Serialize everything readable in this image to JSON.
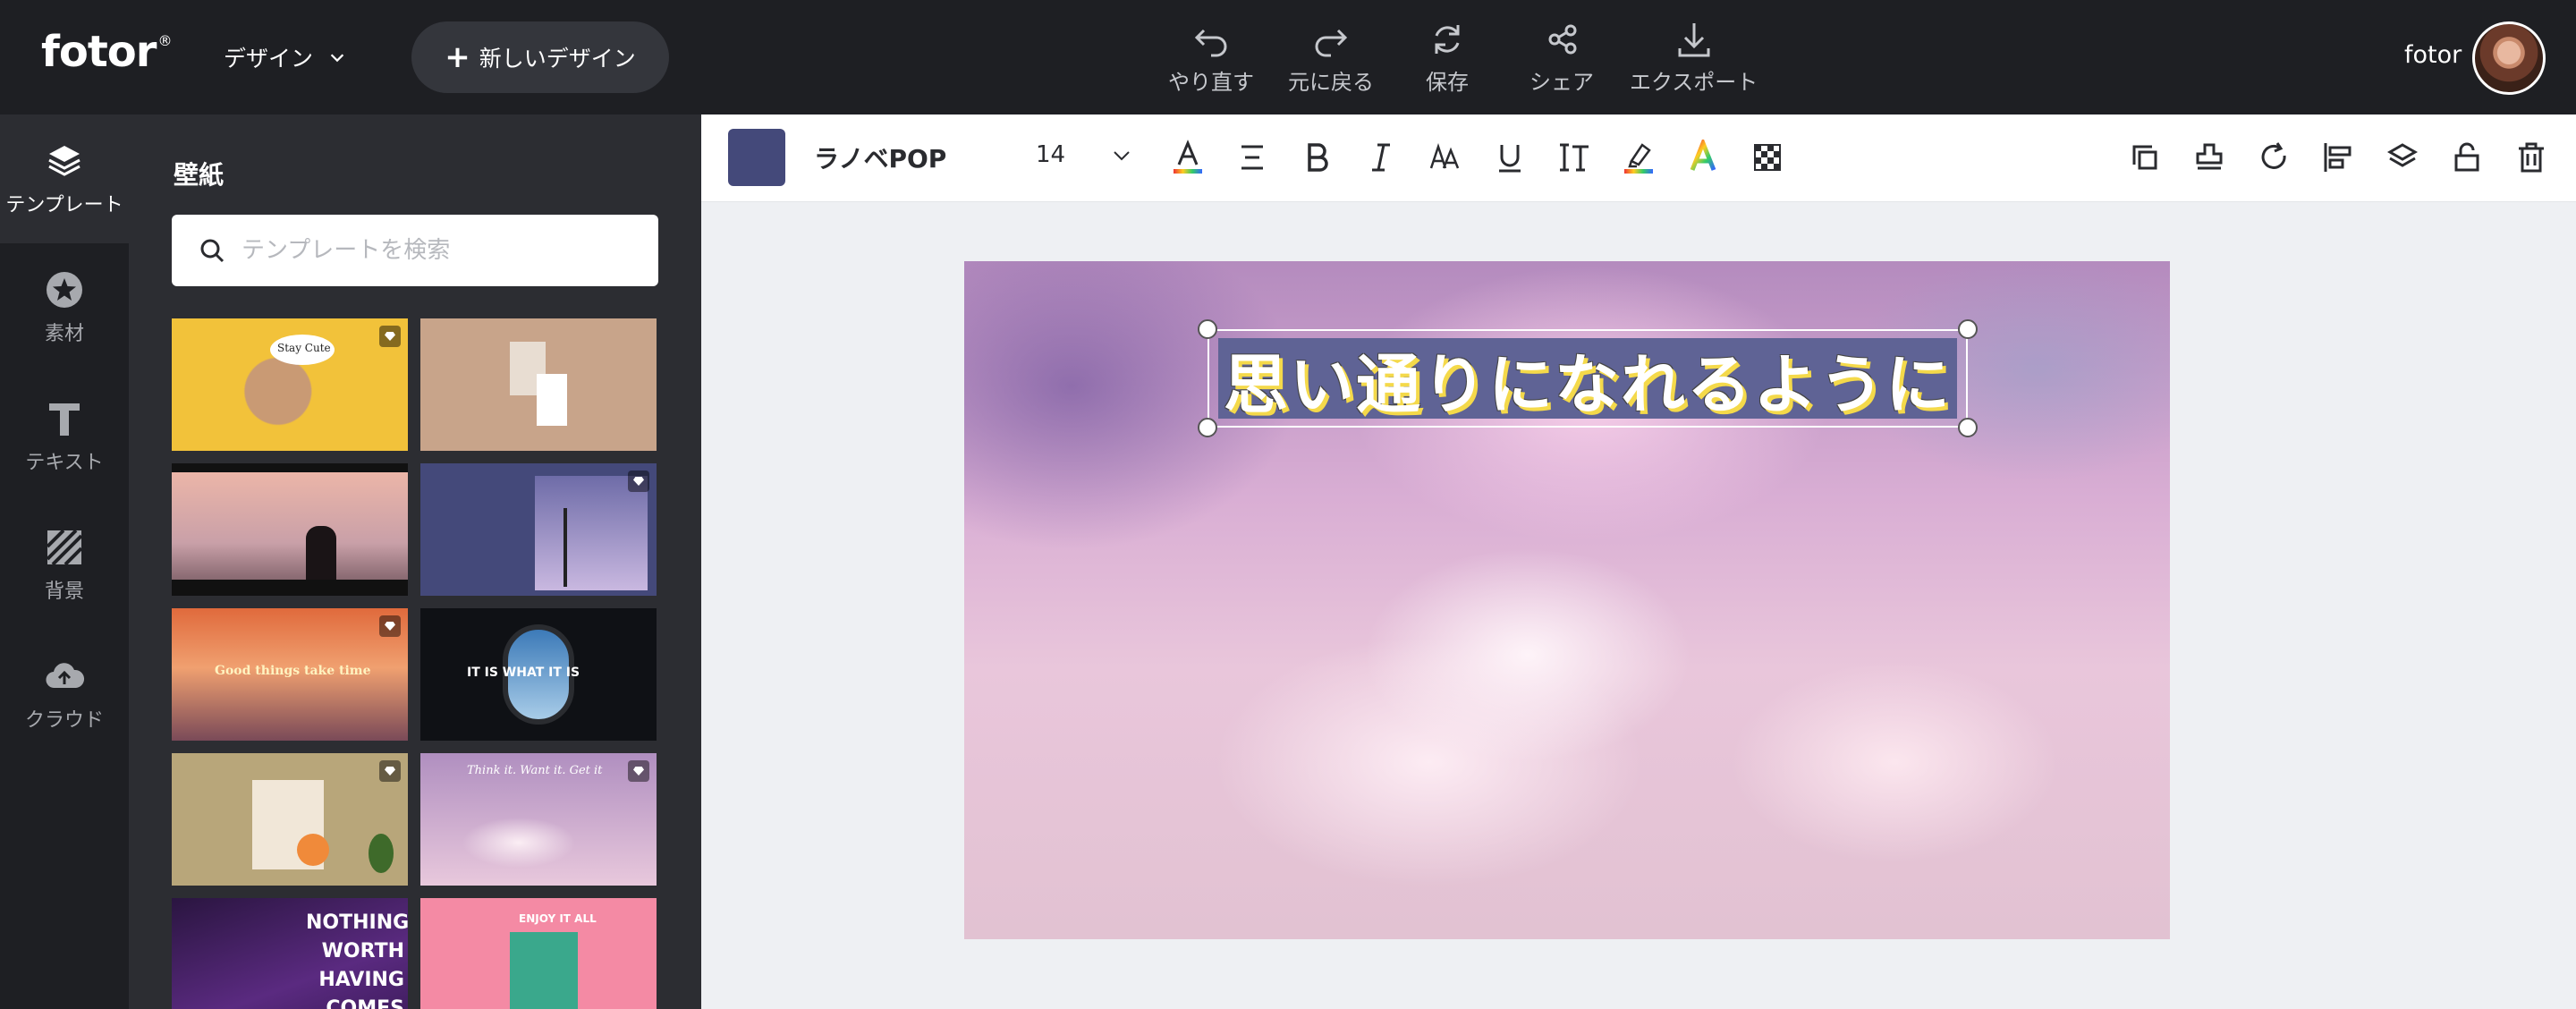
{
  "header": {
    "logo": "fotor",
    "logo_mark": "®",
    "design_menu": "デザイン",
    "new_design": "新しいデザイン",
    "tools": [
      {
        "label": "やり直す",
        "icon": "undo-icon"
      },
      {
        "label": "元に戻る",
        "icon": "redo-icon"
      },
      {
        "label": "保存",
        "icon": "refresh-icon"
      },
      {
        "label": "シェア",
        "icon": "share-icon"
      },
      {
        "label": "エクスポート",
        "icon": "download-icon"
      }
    ],
    "user": "fotor"
  },
  "rail": {
    "items": [
      {
        "label": "テンプレート",
        "icon": "layers-icon",
        "active": true
      },
      {
        "label": "素材",
        "icon": "star-icon"
      },
      {
        "label": "テキスト",
        "icon": "text-t-icon"
      },
      {
        "label": "背景",
        "icon": "background-hatch-icon"
      },
      {
        "label": "クラウド",
        "icon": "cloud-upload-icon"
      }
    ]
  },
  "panel": {
    "title": "壁紙",
    "search_placeholder": "テンプレートを検索",
    "thumbnails": [
      {
        "name": "stay-cute-dog",
        "text": "Stay Cute"
      },
      {
        "name": "beige-photo-cards",
        "text": ""
      },
      {
        "name": "city-window-silhouette",
        "text": ""
      },
      {
        "name": "navy-season-greetings",
        "text": ""
      },
      {
        "name": "sunset-good-things",
        "text": "Good things take time"
      },
      {
        "name": "airplane-window",
        "text": "IT IS WHAT IT IS"
      },
      {
        "name": "collage-beige",
        "text": ""
      },
      {
        "name": "pink-clouds",
        "text": "Think it. Want it. Get it"
      },
      {
        "name": "purple-nothing-worth",
        "text": "NOTHING WORTH HAVING COMES EASY"
      },
      {
        "name": "pink-enjoy-it-all",
        "text": "ENJOY IT ALL"
      }
    ]
  },
  "toolbar": {
    "color": "#44497a",
    "font_name": "ラノベPOP",
    "font_size": "14",
    "text_icons": [
      "font-color-icon",
      "align-icon",
      "bold-icon",
      "italic-icon",
      "letter-case-icon",
      "underline-icon",
      "line-spacing-icon",
      "highlight-icon",
      "gradient-text-icon",
      "transparency-icon"
    ],
    "right_icons": [
      "duplicate-icon",
      "stamp-icon",
      "rotate-icon",
      "align-left-icon",
      "layers-icon",
      "lock-icon",
      "trash-icon"
    ]
  },
  "canvas": {
    "text": "思い通りになれるように",
    "text_bg": "#5f6395",
    "shadow_color": "#f4d94a"
  }
}
